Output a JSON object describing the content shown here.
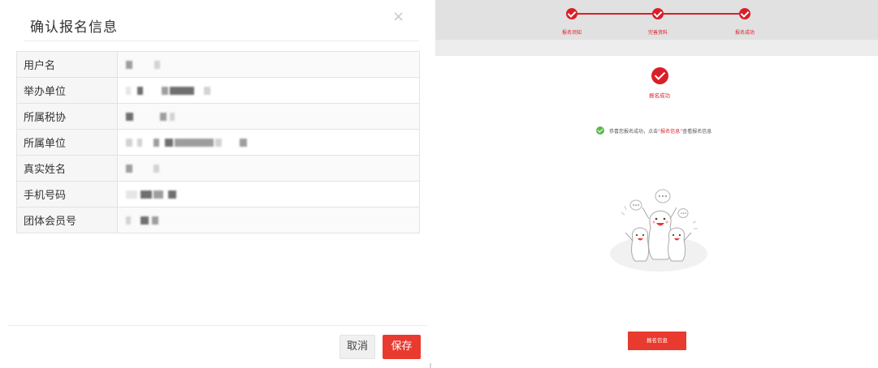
{
  "modal": {
    "title": "确认报名信息",
    "close_symbol": "×",
    "fields": [
      {
        "label": "用户名"
      },
      {
        "label": "举办单位"
      },
      {
        "label": "所属税协"
      },
      {
        "label": "所属单位"
      },
      {
        "label": "真实姓名"
      },
      {
        "label": "手机号码"
      },
      {
        "label": "团体会员号"
      }
    ],
    "cancel_label": "取消",
    "save_label": "保存"
  },
  "steps": [
    {
      "label": "报名须知"
    },
    {
      "label": "完善资料"
    },
    {
      "label": "报名成功"
    }
  ],
  "result": {
    "status": "报名成功",
    "notice_prefix": "恭喜您报名成功，点击",
    "notice_link": "“报名信息”",
    "notice_suffix": "查看报名信息",
    "button_label": "报名信息"
  },
  "colors": {
    "accent": "#e83a2f",
    "step_red": "#d91f2a",
    "success_green": "#5bb84a"
  },
  "icons": [
    "close-icon",
    "check-circle-icon",
    "green-check-icon",
    "celebration-illustration"
  ]
}
